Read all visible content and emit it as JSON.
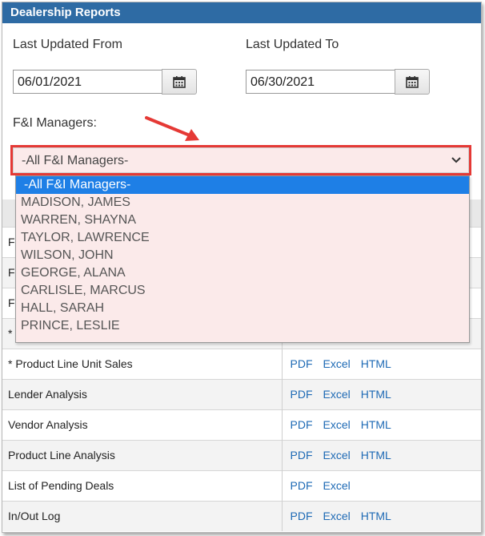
{
  "panel": {
    "title": "Dealership Reports"
  },
  "filters": {
    "from_label": "Last Updated From",
    "from_value": "06/01/2021",
    "to_label": "Last Updated To",
    "to_value": "06/30/2021",
    "managers_label": "F&I Managers:",
    "managers_selected": "-All F&I Managers-"
  },
  "dropdown": {
    "options": [
      "-All F&I Managers-",
      "MADISON, JAMES",
      "WARREN, SHAYNA",
      "TAYLOR, LAWRENCE",
      "WILSON, JOHN",
      "GEORGE, ALANA",
      "CARLISLE, MARCUS",
      "HALL, SARAH",
      "PRINCE, LESLIE"
    ]
  },
  "reports": {
    "hidden_row_prefixes": [
      "F",
      "F",
      "F",
      "*"
    ],
    "rows": [
      {
        "name": "* Product Line Unit Sales",
        "links": [
          "PDF",
          "Excel",
          "HTML"
        ]
      },
      {
        "name": "Lender Analysis",
        "links": [
          "PDF",
          "Excel",
          "HTML"
        ]
      },
      {
        "name": "Vendor Analysis",
        "links": [
          "PDF",
          "Excel",
          "HTML"
        ]
      },
      {
        "name": "Product Line Analysis",
        "links": [
          "PDF",
          "Excel",
          "HTML"
        ]
      },
      {
        "name": "List of Pending Deals",
        "links": [
          "PDF",
          "Excel"
        ]
      },
      {
        "name": "In/Out Log",
        "links": [
          "PDF",
          "Excel",
          "HTML"
        ]
      }
    ]
  },
  "colors": {
    "header_bg": "#2e6ba4",
    "highlight_border": "#e53935",
    "link": "#1e6ab5",
    "selected_option": "#1e7fe6"
  }
}
